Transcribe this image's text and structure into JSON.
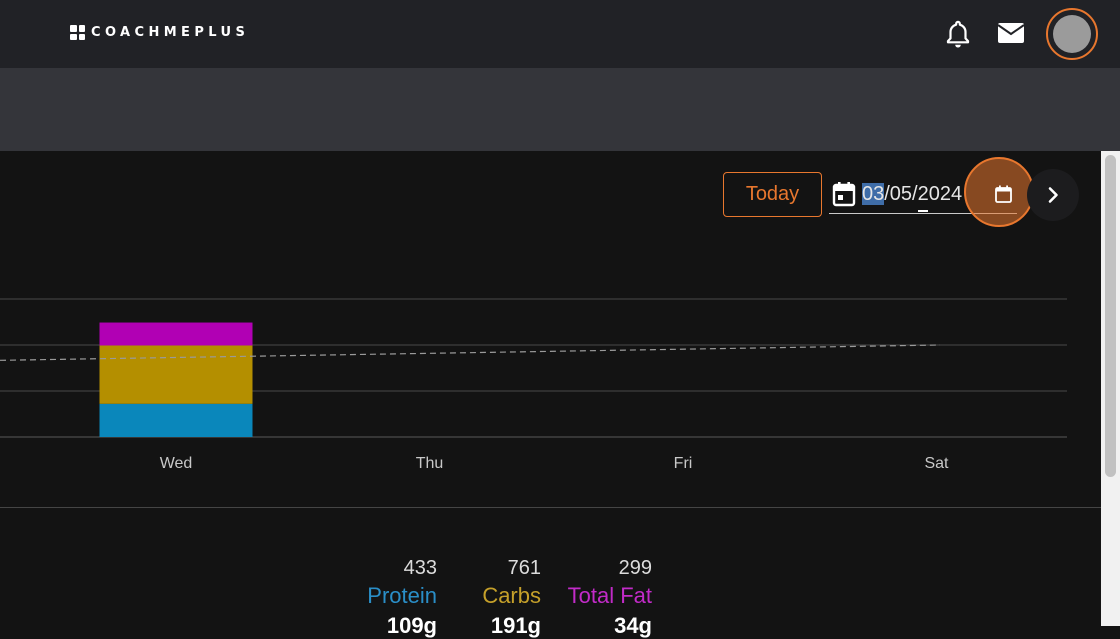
{
  "app": {
    "logo_text": "COACHMEPLUS"
  },
  "header": {
    "notifications_icon": "bell-icon",
    "messages_icon": "mail-icon",
    "accent_color": "#e8772e"
  },
  "controls": {
    "today_label": "Today",
    "date_month": "03",
    "date_rest": "/05/2024"
  },
  "chart_data": {
    "type": "bar",
    "categories": [
      "Wed",
      "Thu",
      "Fri",
      "Sat"
    ],
    "series": [
      {
        "name": "Protein",
        "color": "#0a87bb",
        "values": [
          433,
          0,
          0,
          0
        ]
      },
      {
        "name": "Carbs",
        "color": "#b48f00",
        "values": [
          761,
          0,
          0,
          0
        ]
      },
      {
        "name": "Total Fat",
        "color": "#b100b4",
        "values": [
          299,
          0,
          0,
          0
        ]
      }
    ],
    "target_line": {
      "style": "dashed",
      "start": 1000,
      "end": 1200
    },
    "ylim": [
      0,
      1800
    ],
    "grid": true
  },
  "macros": [
    {
      "total": "433",
      "label": "Protein",
      "grams": "109g",
      "color": "#2a8ec7"
    },
    {
      "total": "761",
      "label": "Carbs",
      "grams": "191g",
      "color": "#c5a02a"
    },
    {
      "total": "299",
      "label": "Total Fat",
      "grams": "34g",
      "color": "#c22bc8"
    }
  ]
}
